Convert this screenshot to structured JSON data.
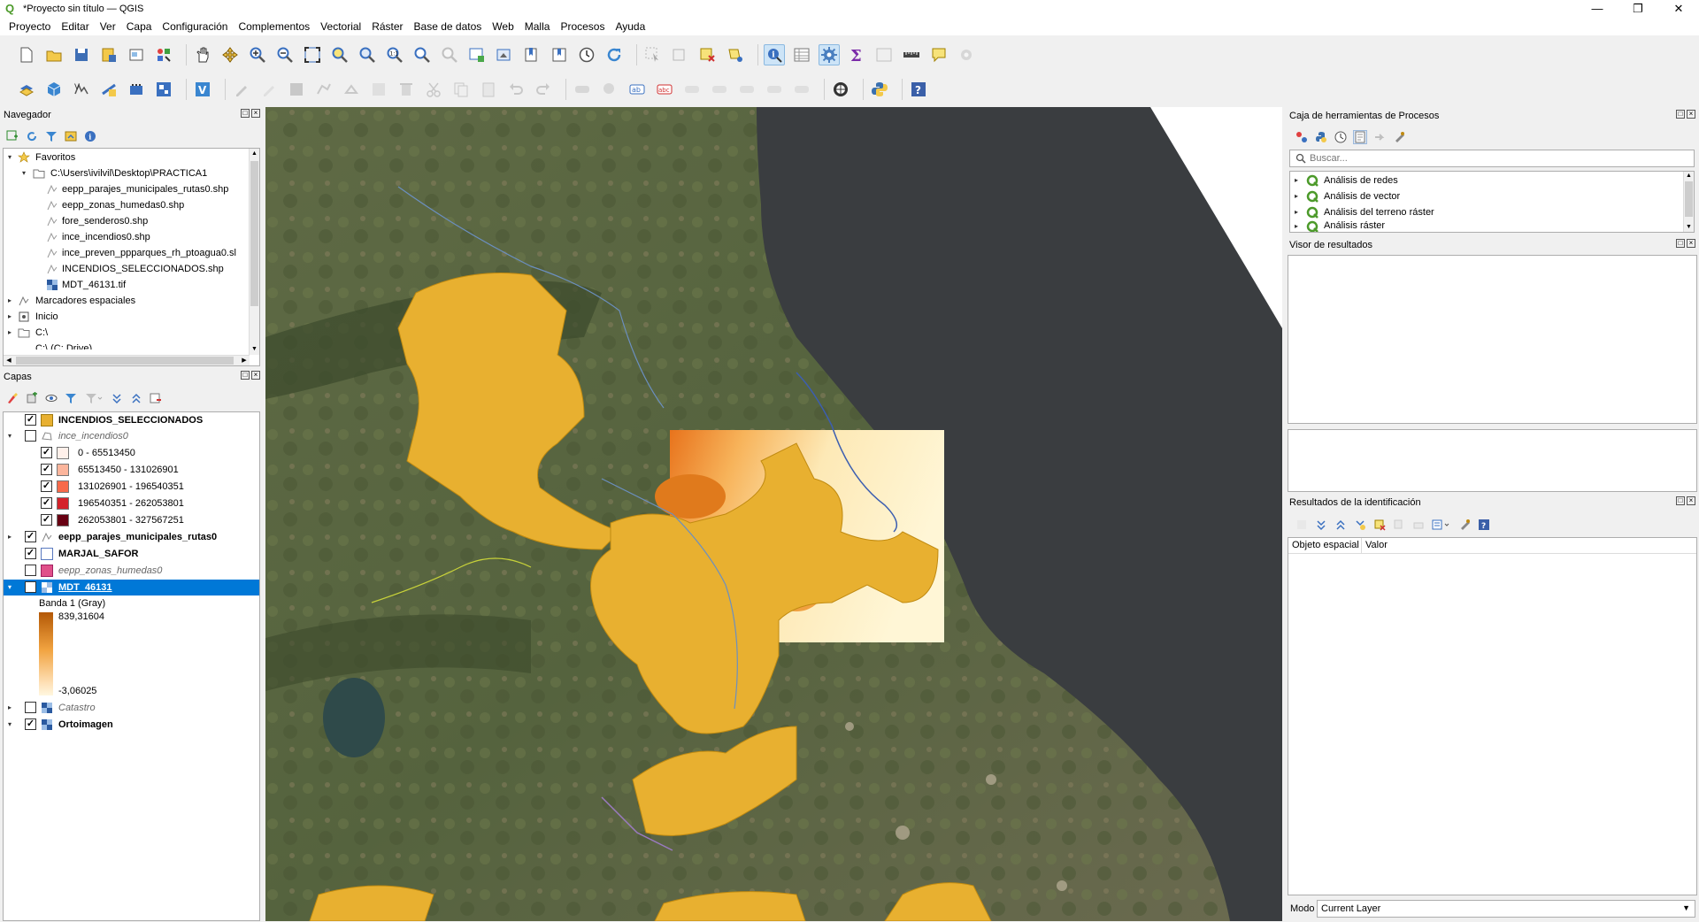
{
  "window": {
    "title": "*Proyecto sin título — QGIS",
    "min": "—",
    "max": "❐",
    "close": "✕"
  },
  "menu": [
    "Proyecto",
    "Editar",
    "Ver",
    "Capa",
    "Configuración",
    "Complementos",
    "Vectorial",
    "Ráster",
    "Base de datos",
    "Web",
    "Malla",
    "Procesos",
    "Ayuda"
  ],
  "navigator": {
    "title": "Navegador",
    "items": [
      {
        "label": "Favoritos",
        "icon": "star-icon"
      },
      {
        "label": "C:\\Users\\ivilvil\\Desktop\\PRACTICA1",
        "icon": "folder-icon"
      },
      {
        "label": "eepp_parajes_municipales_rutas0.shp",
        "icon": "line-layer-icon"
      },
      {
        "label": "eepp_zonas_humedas0.shp",
        "icon": "line-layer-icon"
      },
      {
        "label": "fore_senderos0.shp",
        "icon": "line-layer-icon"
      },
      {
        "label": "ince_incendios0.shp",
        "icon": "line-layer-icon"
      },
      {
        "label": "ince_preven_ppparques_rh_ptoagua0.sl",
        "icon": "line-layer-icon"
      },
      {
        "label": "INCENDIOS_SELECCIONADOS.shp",
        "icon": "line-layer-icon"
      },
      {
        "label": "MDT_46131.tif",
        "icon": "raster-icon"
      },
      {
        "label": "Marcadores espaciales",
        "icon": "bookmark-icon"
      },
      {
        "label": "Inicio",
        "icon": "home-icon"
      },
      {
        "label": "C:\\",
        "icon": "folder-icon"
      },
      {
        "label": "C:\\ (C: Drive)",
        "icon": "drive-icon"
      }
    ]
  },
  "layers": {
    "title": "Capas",
    "items": [
      {
        "label": "INCENDIOS_SELECCIONADOS",
        "checked": true,
        "swatch": "#e8b030"
      },
      {
        "label": "ince_incendios0",
        "checked": false
      },
      {
        "label": "0 - 65513450",
        "checked": true,
        "swatch": "#fff0ea"
      },
      {
        "label": "65513450 - 131026901",
        "checked": true,
        "swatch": "#fcb59c"
      },
      {
        "label": "131026901 - 196540351",
        "checked": true,
        "swatch": "#f76a4a"
      },
      {
        "label": "196540351 - 262053801",
        "checked": true,
        "swatch": "#d4222a"
      },
      {
        "label": "262053801 - 327567251",
        "checked": true,
        "swatch": "#680012"
      },
      {
        "label": "eepp_parajes_municipales_rutas0",
        "checked": true
      },
      {
        "label": "MARJAL_SAFOR",
        "checked": true,
        "swatch": "#ffffff"
      },
      {
        "label": "eepp_zonas_humedas0",
        "checked": false,
        "swatch": "#e0508a"
      },
      {
        "label": "MDT_46131",
        "checked": true
      },
      {
        "label": "Banda 1 (Gray)"
      },
      {
        "label": "839,31604"
      },
      {
        "label": "-3,06025"
      },
      {
        "label": "Catastro",
        "checked": false
      },
      {
        "label": "Ortoimagen",
        "checked": true
      }
    ]
  },
  "processing": {
    "title": "Caja de herramientas de Procesos",
    "search_placeholder": "Buscar...",
    "items": [
      "Análisis de redes",
      "Análisis de vector",
      "Análisis del terreno ráster",
      "Análisis ráster"
    ]
  },
  "results_viewer": {
    "title": "Visor de resultados"
  },
  "identify": {
    "title": "Resultados de la identificación",
    "col1": "Objeto espacial",
    "col2": "Valor",
    "mode_label": "Modo",
    "mode_value": "Current Layer"
  },
  "colors": {
    "selection": "#0078d7",
    "fire": "#e8b030",
    "sea": "#3a3d40"
  }
}
